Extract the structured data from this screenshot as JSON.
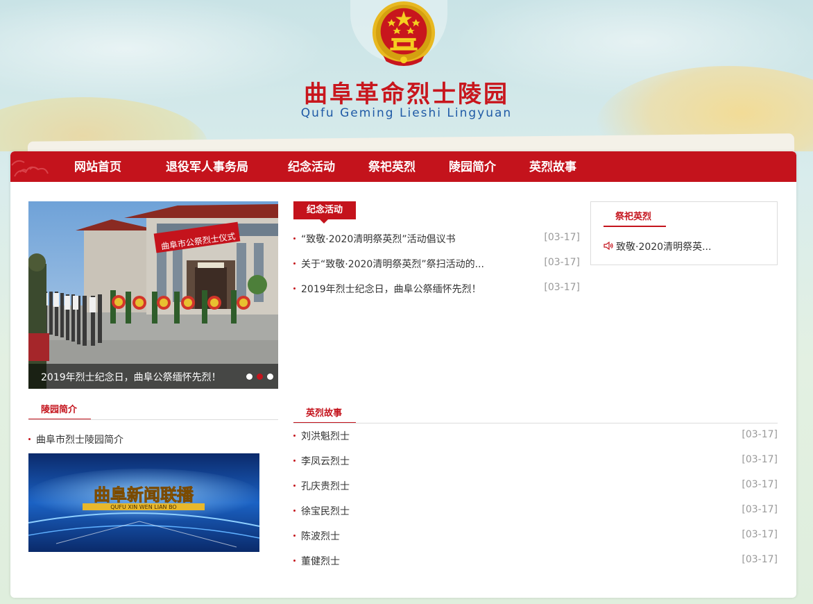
{
  "header": {
    "title": "曲阜革命烈士陵园",
    "subtitle": "Qufu Geming Lieshi Lingyuan",
    "emblem_icon": "national-emblem-icon"
  },
  "nav": {
    "items": [
      {
        "label": "网站首页"
      },
      {
        "label": "退役军人事务局"
      },
      {
        "label": "纪念活动"
      },
      {
        "label": "祭祀英烈"
      },
      {
        "label": "陵园简介"
      },
      {
        "label": "英烈故事"
      }
    ]
  },
  "slider": {
    "caption": "2019年烈士纪念日，曲阜公祭缅怀先烈！",
    "banner_text": "曲阜市公祭烈士仪式",
    "active_dot": 2,
    "dot_count": 3
  },
  "activities": {
    "tab_label": "纪念活动",
    "items": [
      {
        "title": "“致敬·2020清明祭英烈”活动倡议书",
        "date": "[03-17]"
      },
      {
        "title": "关于“致敬·2020清明祭英烈”祭扫活动的...",
        "date": "[03-17]"
      },
      {
        "title": "2019年烈士纪念日，曲阜公祭缅怀先烈！",
        "date": "[03-17]"
      }
    ]
  },
  "sacrifice": {
    "tab_label": "祭祀英烈",
    "item": "致敬·2020清明祭英...",
    "icon": "speaker-icon"
  },
  "intro": {
    "tab_label": "陵园简介",
    "item": "曲阜市烈士陵园简介",
    "video_title": "曲阜新闻联播",
    "video_subtitle": "QUFU XIN WEN LIAN BO"
  },
  "stories": {
    "tab_label": "英烈故事",
    "items": [
      {
        "title": "刘洪魁烈士",
        "date": "[03-17]"
      },
      {
        "title": "李凤云烈士",
        "date": "[03-17]"
      },
      {
        "title": "孔庆贵烈士",
        "date": "[03-17]"
      },
      {
        "title": "徐宝民烈士",
        "date": "[03-17]"
      },
      {
        "title": "陈波烈士",
        "date": "[03-17]"
      },
      {
        "title": "董健烈士",
        "date": "[03-17]"
      }
    ]
  },
  "colors": {
    "brand_red": "#c4131c",
    "subtitle_blue": "#1f5aa6",
    "date_gray": "#999999"
  }
}
